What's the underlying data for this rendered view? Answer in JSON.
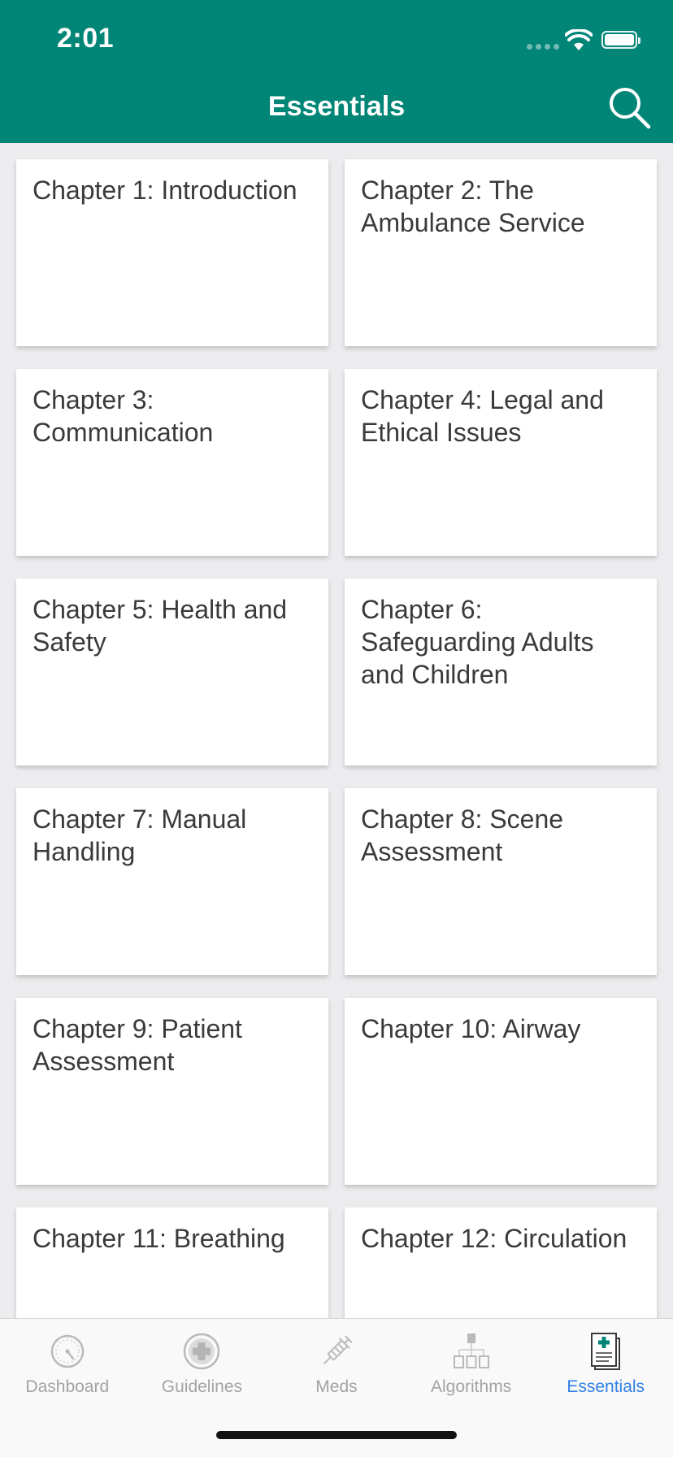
{
  "status_bar": {
    "time": "2:01"
  },
  "header": {
    "title": "Essentials",
    "background_color": "#008577",
    "search_icon": "search-icon"
  },
  "chapters": [
    "Chapter 1: Introduction",
    "Chapter 2: The Ambulance Service",
    "Chapter 3: Communication",
    "Chapter 4: Legal and Ethical Issues",
    "Chapter 5: Health and Safety",
    "Chapter 6: Safeguarding Adults and Children",
    "Chapter 7: Manual Handling",
    "Chapter 8: Scene Assessment",
    "Chapter 9: Patient Assessment",
    "Chapter 10: Airway",
    "Chapter 11: Breathing",
    "Chapter 12: Circulation"
  ],
  "tab_bar": {
    "active_color": "#2f7fe6",
    "inactive_color": "#a3a3a3",
    "tabs": [
      {
        "label": "Dashboard",
        "icon": "dashboard-gauge-icon"
      },
      {
        "label": "Guidelines",
        "icon": "medical-cross-icon"
      },
      {
        "label": "Meds",
        "icon": "syringe-icon"
      },
      {
        "label": "Algorithms",
        "icon": "flowchart-icon"
      },
      {
        "label": "Essentials",
        "icon": "document-medical-icon",
        "active": true
      }
    ]
  }
}
